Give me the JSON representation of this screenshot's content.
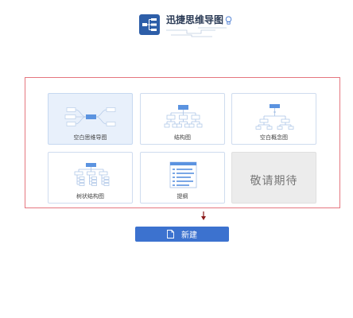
{
  "app": {
    "title": "迅捷思维导图",
    "logo_icon": "mindmap-logo-icon",
    "bulb_icon": "lightbulb-icon"
  },
  "templates": [
    {
      "label": "空白思维导图",
      "icon": "mindmap-icon",
      "selected": true
    },
    {
      "label": "结构图",
      "icon": "org-chart-icon",
      "selected": false
    },
    {
      "label": "空白概念图",
      "icon": "concept-map-icon",
      "selected": false
    },
    {
      "label": "树状结构图",
      "icon": "tree-chart-icon",
      "selected": false
    },
    {
      "label": "提纲",
      "icon": "outline-icon",
      "selected": false
    }
  ],
  "coming_soon": {
    "label": "敬请期待"
  },
  "actions": {
    "new_label": "新建",
    "new_icon": "new-file-icon"
  },
  "colors": {
    "accent": "#3c72cf",
    "highlight_frame": "#e5767f",
    "logo": "#2d5ea8"
  }
}
